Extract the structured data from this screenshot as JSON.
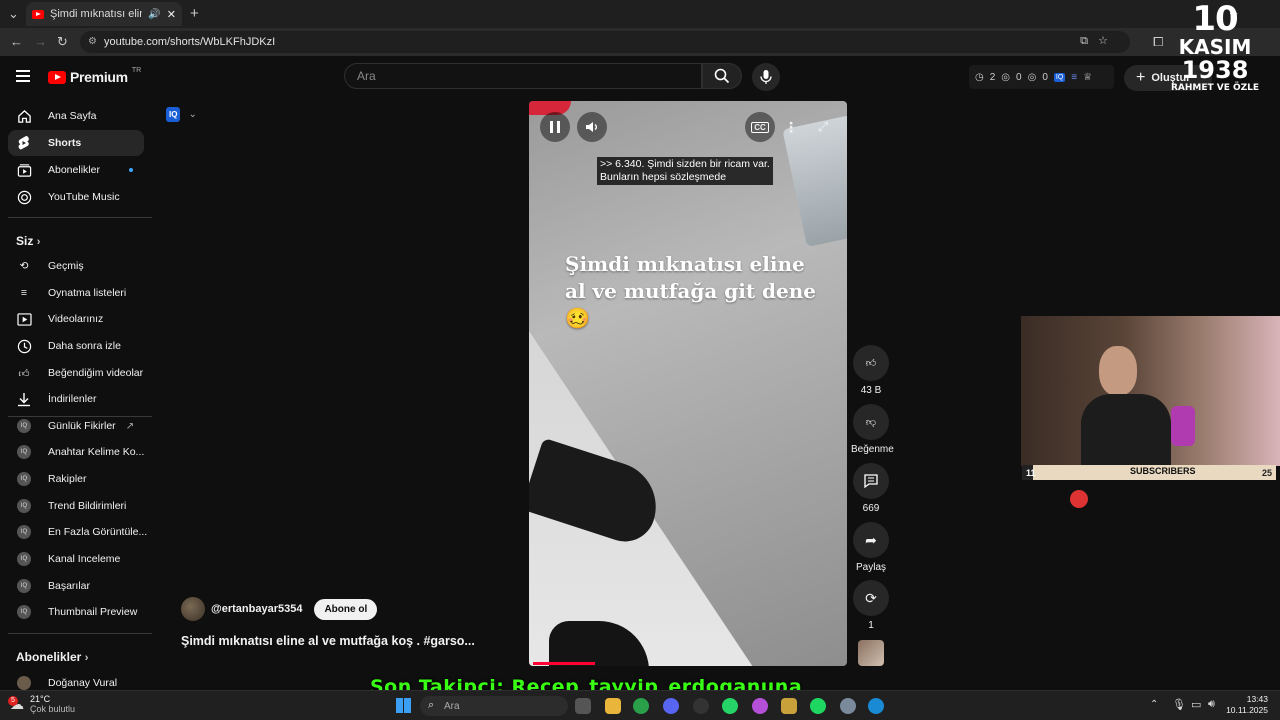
{
  "browser": {
    "tab_title": "Şimdi mıknatısı eline al ve m",
    "url": "youtube.com/shorts/WbLKFhJDKzI"
  },
  "header": {
    "logo_text": "Premium",
    "logo_region": "TR",
    "search_placeholder": "Ara",
    "stats": {
      "a": "2",
      "b": "0",
      "c": "0"
    },
    "create_label": "Oluştur"
  },
  "sidebar": {
    "main": [
      {
        "label": "Ana Sayfa",
        "icon": "home-icon"
      },
      {
        "label": "Shorts",
        "icon": "shorts-icon"
      },
      {
        "label": "Abonelikler",
        "icon": "subscriptions-icon"
      },
      {
        "label": "YouTube Music",
        "icon": "music-icon"
      }
    ],
    "you_heading": "Siz",
    "you": [
      {
        "label": "Geçmiş"
      },
      {
        "label": "Oynatma listeleri"
      },
      {
        "label": "Videolarınız"
      },
      {
        "label": "Daha sonra izle"
      },
      {
        "label": "Beğendiğim videolar"
      },
      {
        "label": "İndirilenler"
      }
    ],
    "tools": [
      {
        "label": "Günlük Fikirler"
      },
      {
        "label": "Anahtar Kelime Ko..."
      },
      {
        "label": "Rakipler"
      },
      {
        "label": "Trend Bildirimleri"
      },
      {
        "label": "En Fazla Görüntüle..."
      },
      {
        "label": "Kanal Inceleme"
      },
      {
        "label": "Başarılar"
      },
      {
        "label": "Thumbnail Preview"
      }
    ],
    "subs_heading": "Abonelikler",
    "subs": [
      {
        "label": "Doğanay Vural"
      }
    ]
  },
  "video": {
    "caption": ">> 6.340. Şimdi sizden bir ricam var.\nBunların hepsi sözleşmede",
    "overlay": "Şimdi mıknatısı eline al ve mutfağa git dene 🥴",
    "progress": 0.2
  },
  "actions": {
    "likes": "43 B",
    "dislike_label": "Beğenme",
    "comments": "669",
    "share_label": "Paylaş",
    "remix": "1"
  },
  "channel": {
    "handle": "@ertanbayar5354",
    "subscribe_label": "Abone ol",
    "title": "Şimdi mıknatısı eline al ve mutfağa koş . #garso..."
  },
  "stream": {
    "sub_left": "11",
    "sub_label": "SUBSCRIBERS",
    "sub_right": "25",
    "logo_line1": "10",
    "logo_line2": "KASIM",
    "logo_line3": "1938",
    "logo_line4": "RAHMET VE ÖZLE",
    "ticker": "Son Takipçi: Recep_tayyip_erdoganuna"
  },
  "taskbar": {
    "weather_temp": "21°C",
    "weather_desc": "Çok bulutlu",
    "badge": "5",
    "search_placeholder": "Ara",
    "time": "13:43",
    "date": "10.11.2025"
  }
}
